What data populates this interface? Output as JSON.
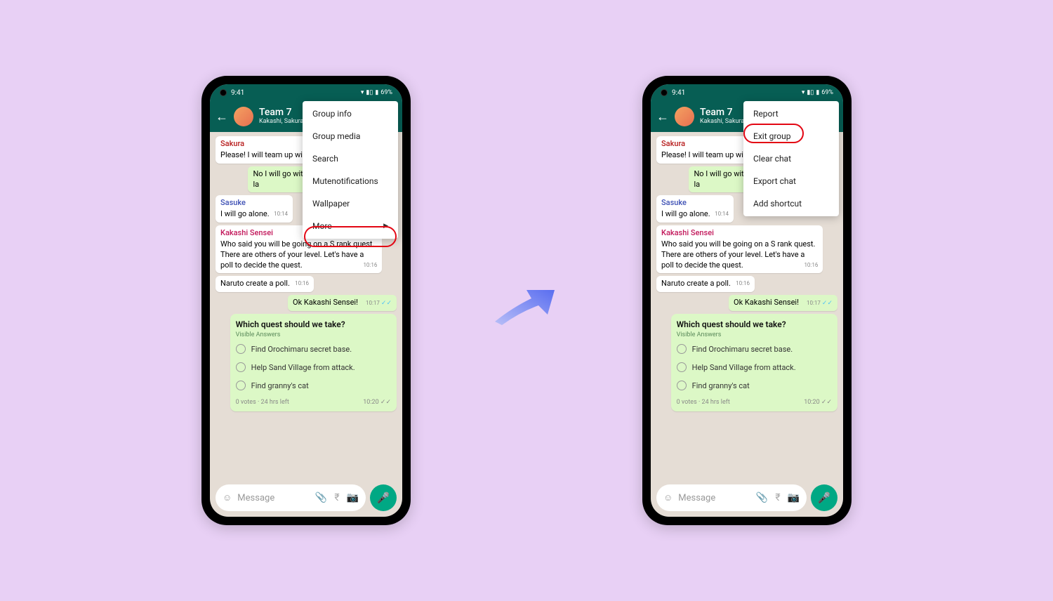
{
  "status": {
    "time": "9:41",
    "battery": "69%"
  },
  "header": {
    "group": "Team 7",
    "members": "Kakashi, Sakura, Sasu"
  },
  "messages": {
    "m1": {
      "sender": "Sakura",
      "text": "Please! I will team up with rank quest."
    },
    "m2": {
      "text": "No I will go with you with Jiraya sensei la"
    },
    "m3": {
      "sender": "Sasuke",
      "text": "I will go alone.",
      "time": "10:14"
    },
    "m4": {
      "sender": "Kakashi Sensei",
      "text": "Who said you will be going on a S rank quest. There are others of your level. Let's have a poll to decide the quest.",
      "time": "10:16"
    },
    "m5": {
      "text": "Naruto create a poll.",
      "time": "10:16"
    },
    "m6": {
      "text": "Ok Kakashi Sensei!",
      "time": "10:17"
    }
  },
  "poll": {
    "title": "Which quest should we take?",
    "visible": "Visible Answers",
    "opt1": "Find Orochimaru secret base.",
    "opt2": "Help Sand Village from attack.",
    "opt3": "Find granny's cat",
    "votes": "0 votes · 24 hrs left",
    "time": "10:20"
  },
  "input": {
    "placeholder": "Message"
  },
  "menu1": {
    "i1": "Group info",
    "i2": "Group media",
    "i3": "Search",
    "i4": "Mutenotifications",
    "i5": "Wallpaper",
    "i6": "More"
  },
  "menu2": {
    "i1": "Report",
    "i2": "Exit group",
    "i3": "Clear chat",
    "i4": "Export chat",
    "i5": "Add shortcut"
  }
}
